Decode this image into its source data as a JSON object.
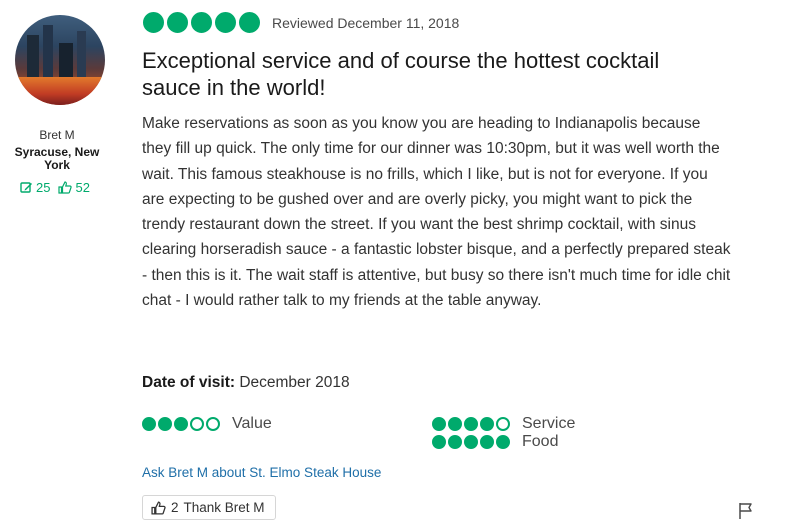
{
  "reviewer": {
    "name": "Bret M",
    "location": "Syracuse, New York",
    "contributions": "25",
    "helpful_votes": "52"
  },
  "review": {
    "rating": 5,
    "max_rating": 5,
    "reviewed_date": "Reviewed December 11, 2018",
    "title": "Exceptional service and of course the hottest cocktail sauce in the world!",
    "body": "Make reservations as soon as you know you are heading to Indianapolis because they fill up quick. The only time for our dinner was 10:30pm, but it was well worth the wait. This famous steakhouse is no frills, which I like, but is not for everyone. If you are expecting to be gushed over and are overly picky, you might want to pick the trendy restaurant down the street. If you want the best shrimp cocktail, with sinus clearing horseradish sauce - a fantastic lobster bisque, and a perfectly prepared steak - then this is it. The wait staff is attentive, but busy so there isn't much time for idle chit chat - I would rather talk to my friends at the table anyway.",
    "date_of_visit_label": "Date of visit:",
    "date_of_visit": "December 2018",
    "sub_ratings": {
      "value": {
        "label": "Value",
        "rating": 3
      },
      "service": {
        "label": "Service",
        "rating": 4
      },
      "food": {
        "label": "Food",
        "rating": 5
      }
    }
  },
  "actions": {
    "ask_link": "Ask Bret M about St. Elmo Steak House",
    "thank_count": "2",
    "thank_label": "Thank Bret M"
  },
  "icons": {
    "contributions": "edit-icon",
    "helpful": "thumbs-up-icon",
    "report": "flag-icon"
  },
  "colors": {
    "bubble_green": "#00aa6c",
    "link_blue": "#1f6fa8"
  }
}
